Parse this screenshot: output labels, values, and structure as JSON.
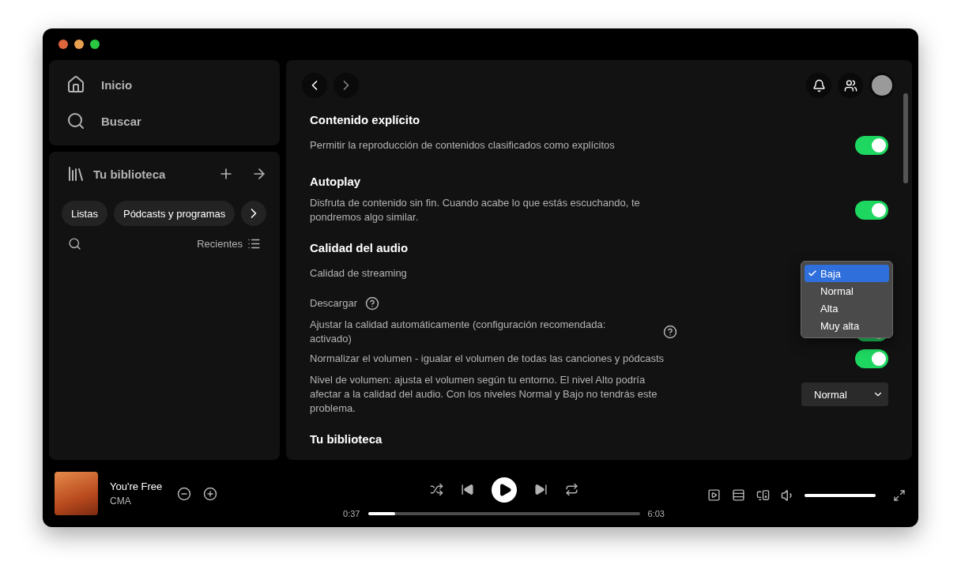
{
  "nav": [
    {
      "label": "Inicio"
    },
    {
      "label": "Buscar"
    }
  ],
  "library": {
    "title": "Tu biblioteca",
    "filters": [
      {
        "label": "Listas"
      },
      {
        "label": "Pódcasts y programas"
      }
    ],
    "sort": "Recientes"
  },
  "settings": {
    "sections": [
      {
        "title": "Contenido explícito",
        "items": [
          {
            "kind": "toggle",
            "label": "Permitir la reproducción de contenidos clasificados como explícitos",
            "on": true
          }
        ]
      },
      {
        "title": "Autoplay",
        "items": [
          {
            "kind": "toggle",
            "label": "Disfruta de contenido sin fin. Cuando acabe lo que estás escuchando, te pondremos algo similar.",
            "on": true
          }
        ]
      },
      {
        "title": "Calidad del audio",
        "items": [
          {
            "kind": "menu",
            "label": "Calidad de streaming",
            "options": [
              {
                "label": "Baja",
                "selected": true
              },
              {
                "label": "Normal",
                "selected": false
              },
              {
                "label": "Alta",
                "selected": false
              },
              {
                "label": "Muy alta",
                "selected": false
              }
            ]
          },
          {
            "kind": "plain",
            "label": "Descargar",
            "help": true
          },
          {
            "kind": "toggle",
            "label": "Ajustar la calidad automáticamente (configuración recomendada: activado)",
            "help": true,
            "on": true
          },
          {
            "kind": "toggle",
            "label": "Normalizar el volumen - igualar el volumen de todas las canciones y pódcasts",
            "on": true
          },
          {
            "kind": "select",
            "label": "Nivel de volumen: ajusta el volumen según tu entorno. El nivel Alto podría afectar a la calidad del audio. Con los niveles Normal y Bajo no tendrás este problema.",
            "value": "Normal"
          }
        ]
      },
      {
        "title": "Tu biblioteca"
      }
    ]
  },
  "player": {
    "title": "You're Free",
    "artist": "CMA",
    "elapsed": "0:37",
    "duration": "6:03",
    "progress": {
      "level": 0.1
    },
    "volume": {
      "level": 1.0
    }
  }
}
